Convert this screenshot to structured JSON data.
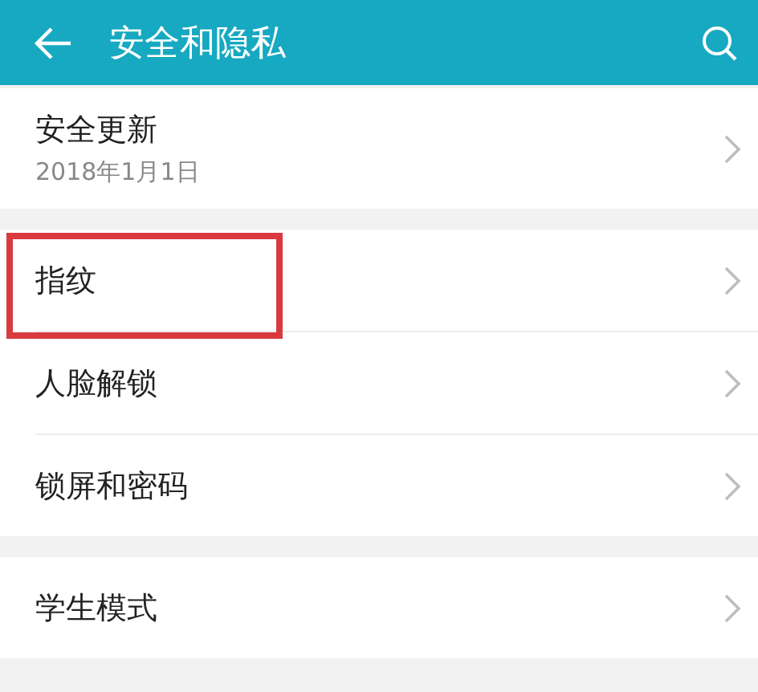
{
  "header": {
    "title": "安全和隐私"
  },
  "groups": [
    {
      "items": [
        {
          "title": "安全更新",
          "subtitle": "2018年1月1日",
          "highlighted": false
        }
      ]
    },
    {
      "items": [
        {
          "title": "指纹",
          "highlighted": true
        },
        {
          "title": "人脸解锁",
          "highlighted": false
        },
        {
          "title": "锁屏和密码",
          "highlighted": false
        }
      ]
    },
    {
      "items": [
        {
          "title": "学生模式",
          "highlighted": false
        }
      ]
    }
  ]
}
